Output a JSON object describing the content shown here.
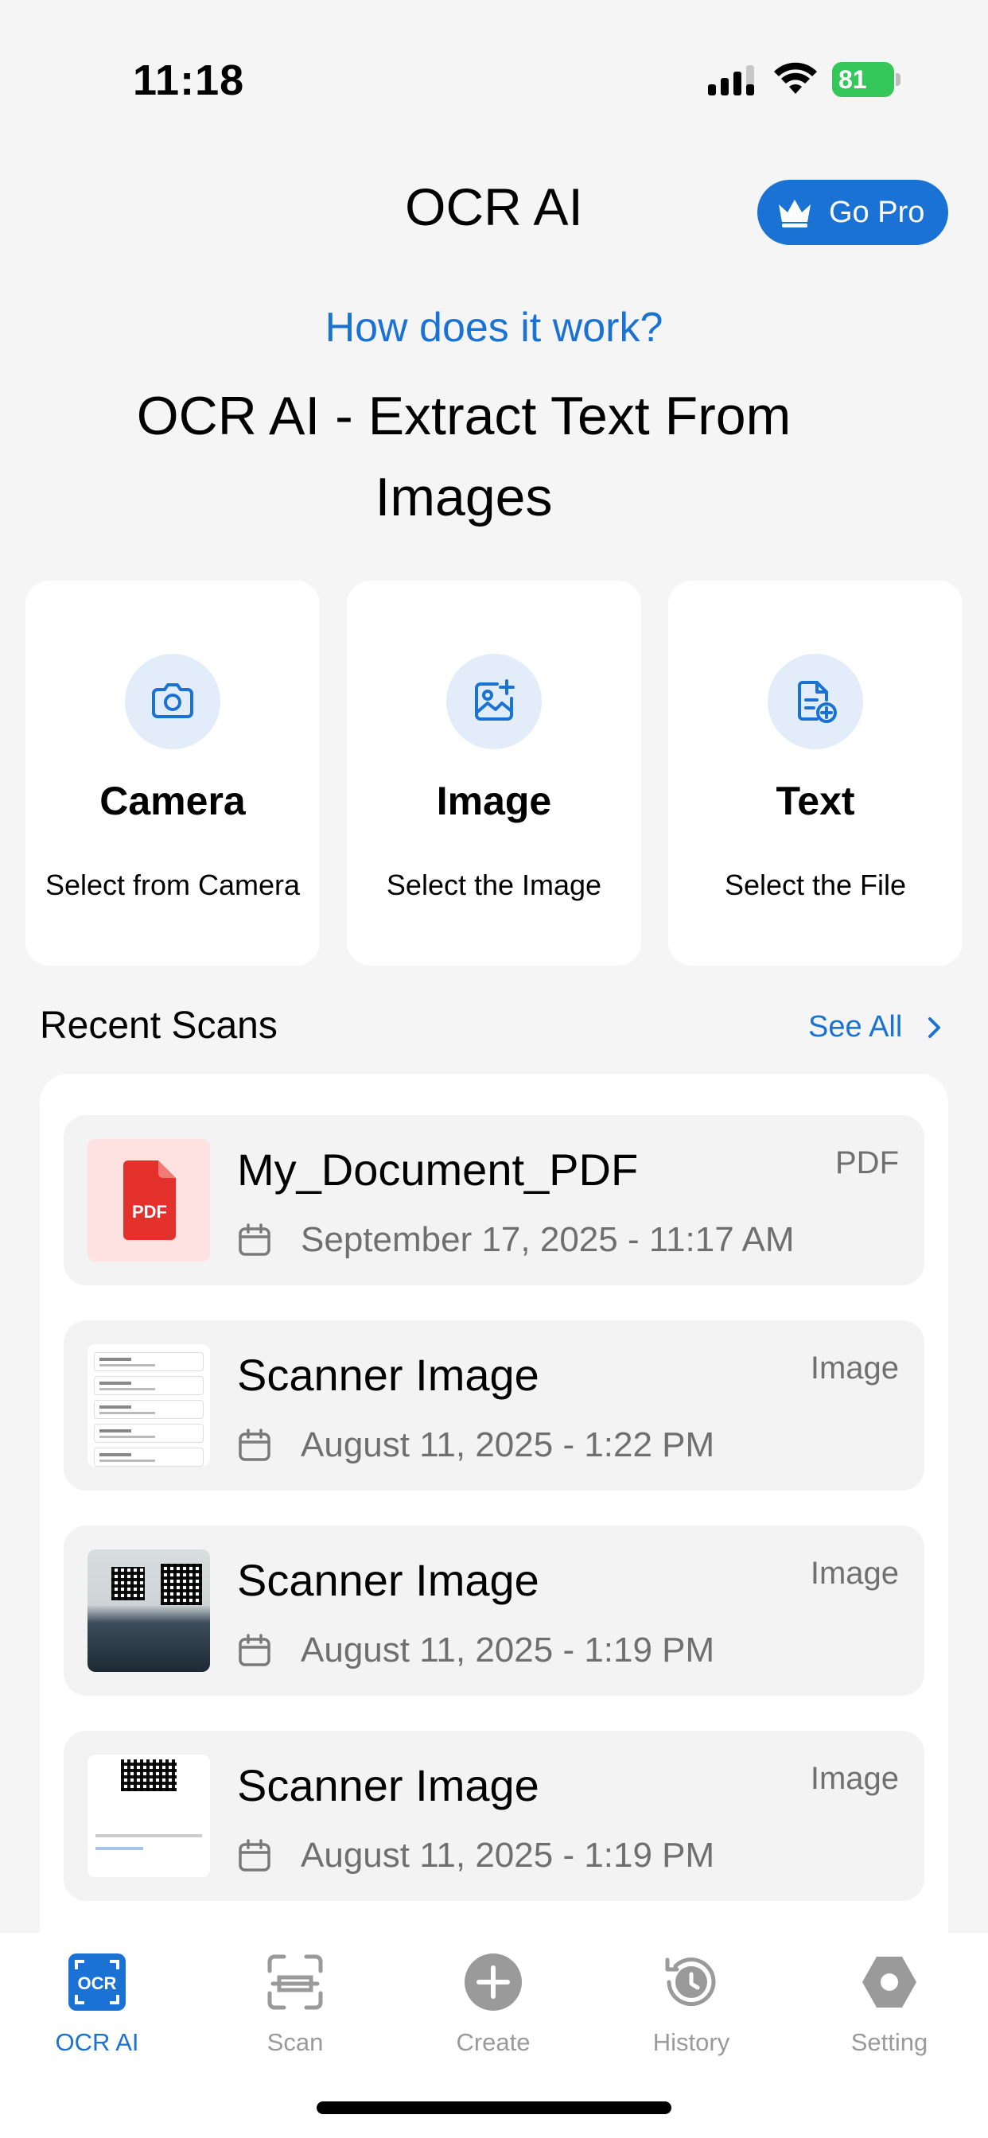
{
  "status_bar": {
    "time": "11:18",
    "battery": "81"
  },
  "header": {
    "title": "OCR AI",
    "go_pro_label": "Go Pro"
  },
  "intro": {
    "how_link": "How does it work?",
    "headline": "OCR AI - Extract Text From Images"
  },
  "actions": [
    {
      "title": "Camera",
      "subtitle": "Select from Camera",
      "icon": "camera-icon"
    },
    {
      "title": "Image",
      "subtitle": "Select the Image",
      "icon": "image-add-icon"
    },
    {
      "title": "Text",
      "subtitle": "Select the File",
      "icon": "file-add-icon"
    }
  ],
  "recent": {
    "title": "Recent Scans",
    "see_all_label": "See All",
    "items": [
      {
        "title": "My_Document_PDF",
        "type": "PDF",
        "date": "September 17, 2025 - 11:17 AM",
        "pdf_label": "PDF"
      },
      {
        "title": "Scanner Image",
        "type": "Image",
        "date": "August 11, 2025 - 1:22 PM"
      },
      {
        "title": "Scanner Image",
        "type": "Image",
        "date": "August 11, 2025 - 1:19 PM"
      },
      {
        "title": "Scanner Image",
        "type": "Image",
        "date": "August 11, 2025 - 1:19 PM"
      }
    ]
  },
  "tabs": [
    {
      "label": "OCR AI",
      "active": true,
      "icon_text": "OCR"
    },
    {
      "label": "Scan",
      "active": false
    },
    {
      "label": "Create",
      "active": false
    },
    {
      "label": "History",
      "active": false
    },
    {
      "label": "Setting",
      "active": false
    }
  ],
  "colors": {
    "accent": "#1a73d4",
    "battery": "#35c759",
    "pdf_red": "#e5312c",
    "tab_inactive": "#9a9a9a"
  }
}
